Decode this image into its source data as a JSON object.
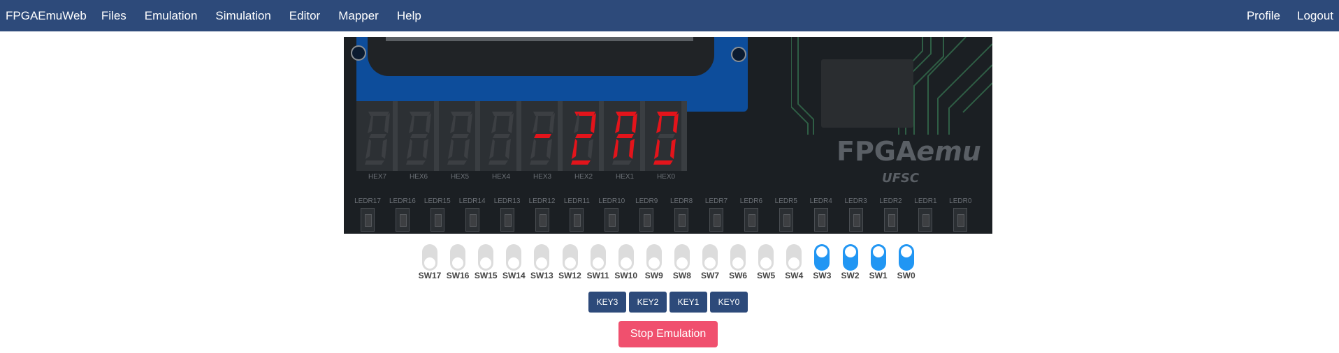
{
  "nav": {
    "brand": "FPGAEmuWeb",
    "items": [
      "Files",
      "Emulation",
      "Simulation",
      "Editor",
      "Mapper",
      "Help"
    ],
    "right_items": [
      "Profile",
      "Logout"
    ]
  },
  "board": {
    "brand_main": "FPGAemu",
    "brand_sub": "UFSC",
    "hex_digits": [
      {
        "label": "HEX7",
        "char": "8",
        "lit": false
      },
      {
        "label": "HEX6",
        "char": "8",
        "lit": false
      },
      {
        "label": "HEX5",
        "char": "8",
        "lit": false
      },
      {
        "label": "HEX4",
        "char": "8",
        "lit": false
      },
      {
        "label": "HEX3",
        "char": "-",
        "lit": true
      },
      {
        "label": "HEX2",
        "char": "2",
        "lit": true
      },
      {
        "label": "HEX1",
        "char": "A",
        "lit": true
      },
      {
        "label": "HEX0",
        "char": "0",
        "lit": true
      }
    ],
    "leds": [
      "LEDR17",
      "LEDR16",
      "LEDR15",
      "LEDR14",
      "LEDR13",
      "LEDR12",
      "LEDR11",
      "LEDR10",
      "LEDR9",
      "LEDR8",
      "LEDR7",
      "LEDR6",
      "LEDR5",
      "LEDR4",
      "LEDR3",
      "LEDR2",
      "LEDR1",
      "LEDR0"
    ],
    "segment_lit_color": "#e3141b",
    "segment_off_color": "#3c3f43"
  },
  "switches": [
    {
      "label": "SW17",
      "on": false
    },
    {
      "label": "SW16",
      "on": false
    },
    {
      "label": "SW15",
      "on": false
    },
    {
      "label": "SW14",
      "on": false
    },
    {
      "label": "SW13",
      "on": false
    },
    {
      "label": "SW12",
      "on": false
    },
    {
      "label": "SW11",
      "on": false
    },
    {
      "label": "SW10",
      "on": false
    },
    {
      "label": "SW9",
      "on": false
    },
    {
      "label": "SW8",
      "on": false
    },
    {
      "label": "SW7",
      "on": false
    },
    {
      "label": "SW6",
      "on": false
    },
    {
      "label": "SW5",
      "on": false
    },
    {
      "label": "SW4",
      "on": false
    },
    {
      "label": "SW3",
      "on": true
    },
    {
      "label": "SW2",
      "on": true
    },
    {
      "label": "SW1",
      "on": true
    },
    {
      "label": "SW0",
      "on": true
    }
  ],
  "keys": [
    "KEY3",
    "KEY2",
    "KEY1",
    "KEY0"
  ],
  "stop_button": "Stop Emulation",
  "colors": {
    "navbar": "#2d4a7a",
    "switch_on": "#2196f3",
    "stop_button": "#f0506e"
  }
}
